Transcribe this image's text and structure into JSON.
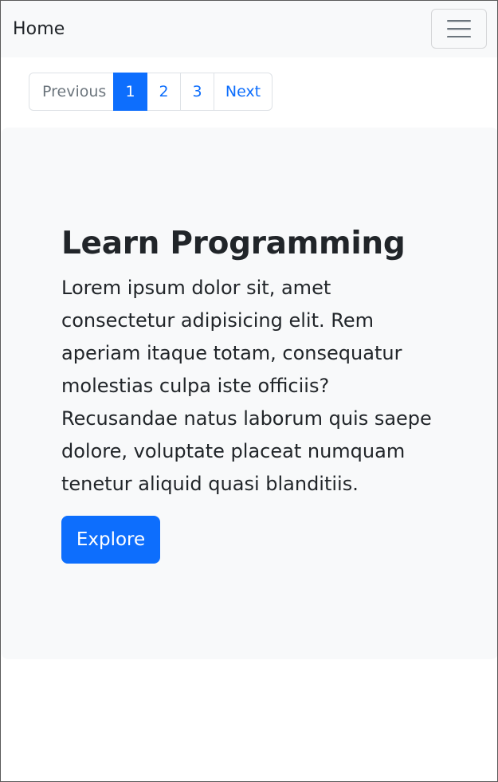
{
  "navbar": {
    "brand": "Home",
    "toggler_icon": "hamburger-menu-icon"
  },
  "pagination": {
    "previous": "Previous",
    "pages": [
      "1",
      "2",
      "3"
    ],
    "active_page": "1",
    "next": "Next"
  },
  "hero": {
    "title": "Learn Programming",
    "text": "Lorem ipsum dolor sit, amet consectetur adipisicing elit. Rem aperiam itaque totam, consequatur molestias culpa iste officiis? Recusandae natus laborum quis saepe dolore, voluptate placeat numquam tenetur aliquid quasi blanditiis.",
    "button_label": "Explore"
  },
  "colors": {
    "primary": "#0d6efd",
    "navbar_bg": "#f8f9fa",
    "text": "#212529",
    "muted": "#6c757d"
  }
}
